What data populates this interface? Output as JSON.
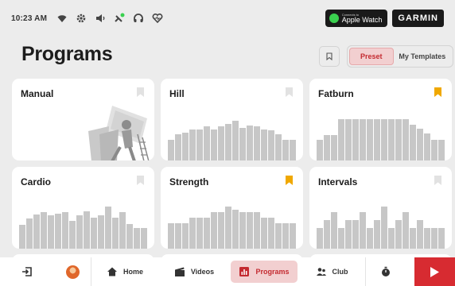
{
  "status_bar": {
    "time": "10:23 AM",
    "icons": [
      "wifi-icon",
      "gear-icon",
      "speaker-icon",
      "pedal-bluetooth-icon",
      "headphones-icon",
      "heart-rate-icon"
    ],
    "apple_watch": {
      "small": "Connects to",
      "big": "Apple Watch"
    },
    "garmin": "GARMIN"
  },
  "header": {
    "title": "Programs",
    "tabs": [
      {
        "label": "Preset",
        "active": true
      },
      {
        "label": "My Templates",
        "active": false
      }
    ]
  },
  "programs": [
    {
      "name": "Manual",
      "bookmarked": false,
      "profile": []
    },
    {
      "name": "Hill",
      "bookmarked": false,
      "profile": [
        26,
        33,
        35,
        39,
        39,
        43,
        39,
        43,
        46,
        50,
        41,
        44,
        43,
        39,
        38,
        33,
        26,
        26
      ]
    },
    {
      "name": "Fatburn",
      "bookmarked": true,
      "profile": [
        26,
        32,
        32,
        52,
        52,
        52,
        52,
        52,
        52,
        52,
        52,
        52,
        52,
        45,
        40,
        34,
        26,
        26
      ]
    },
    {
      "name": "Cardio",
      "bookmarked": false,
      "profile": [
        30,
        38,
        43,
        46,
        42,
        44,
        46,
        35,
        42,
        47,
        39,
        42,
        53,
        39,
        46,
        31,
        26,
        26
      ]
    },
    {
      "name": "Strength",
      "bookmarked": true,
      "profile": [
        32,
        32,
        32,
        39,
        39,
        39,
        46,
        46,
        53,
        49,
        46,
        46,
        46,
        39,
        39,
        32,
        32,
        32
      ]
    },
    {
      "name": "Intervals",
      "bookmarked": false,
      "profile": [
        26,
        36,
        46,
        26,
        36,
        36,
        46,
        26,
        36,
        53,
        26,
        36,
        46,
        26,
        36,
        26,
        26,
        26
      ]
    }
  ],
  "nav": {
    "items": [
      {
        "label": "",
        "icon": "exit-icon"
      },
      {
        "label": "",
        "icon": "avatar"
      },
      {
        "label": "Home",
        "icon": "home-icon"
      },
      {
        "label": "Videos",
        "icon": "clapper-icon"
      },
      {
        "label": "Programs",
        "icon": "chart-icon",
        "active": true
      },
      {
        "label": "Club",
        "icon": "people-icon"
      },
      {
        "label": "",
        "icon": "stopwatch-icon"
      }
    ],
    "play": "play-icon"
  },
  "colors": {
    "accent": "#d72b31",
    "accent_soft": "#f2cfd0",
    "bookmark_active": "#f0a800",
    "bar": "#c7c7c7"
  }
}
